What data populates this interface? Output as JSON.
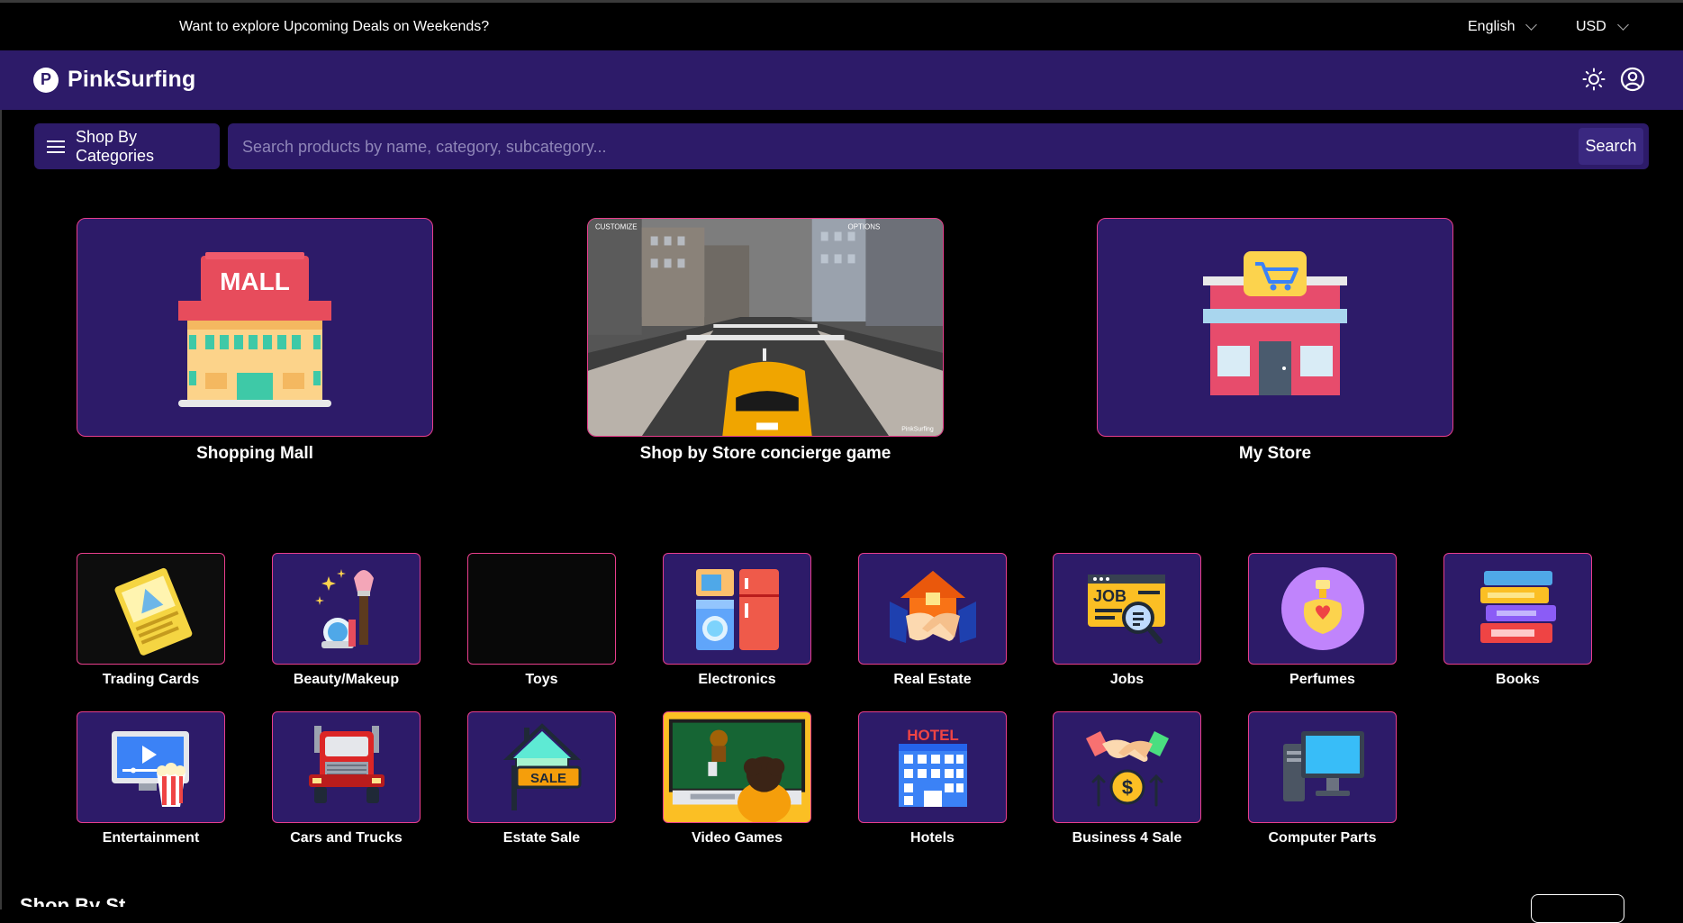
{
  "topbar": {
    "message": "Want to explore Upcoming Deals on Weekends?",
    "language": "English",
    "currency": "USD"
  },
  "header": {
    "logo_letter": "P",
    "brand": "PinkSurfing"
  },
  "search": {
    "category_button": "Shop By Categories",
    "placeholder": "Search products by name, category, subcategory...",
    "button": "Search"
  },
  "featured": [
    {
      "label": "Shopping Mall"
    },
    {
      "label": "Shop by Store concierge game"
    },
    {
      "label": "My Store"
    }
  ],
  "game_overlay": {
    "customize": "CUSTOMIZE",
    "options": "OPTIONS",
    "watermark": "PinkSurfing"
  },
  "mall_sign": "MALL",
  "categories": [
    {
      "label": "Trading Cards"
    },
    {
      "label": "Beauty/Makeup"
    },
    {
      "label": "Toys"
    },
    {
      "label": "Electronics"
    },
    {
      "label": "Real Estate"
    },
    {
      "label": "Jobs"
    },
    {
      "label": "Perfumes"
    },
    {
      "label": "Books"
    },
    {
      "label": "Entertainment"
    },
    {
      "label": "Cars and Trucks"
    },
    {
      "label": "Estate Sale"
    },
    {
      "label": "Video Games"
    },
    {
      "label": "Hotels"
    },
    {
      "label": "Business 4 Sale"
    },
    {
      "label": "Computer Parts"
    }
  ],
  "icon_text": {
    "jobs": "JOB",
    "sale": "SALE",
    "hotel": "HOTEL"
  },
  "bottom": {
    "partial_heading": "Shop By St"
  },
  "colors": {
    "header_bg": "#2d1b69",
    "accent_border": "#e83e8c",
    "page_bg": "#000000"
  }
}
